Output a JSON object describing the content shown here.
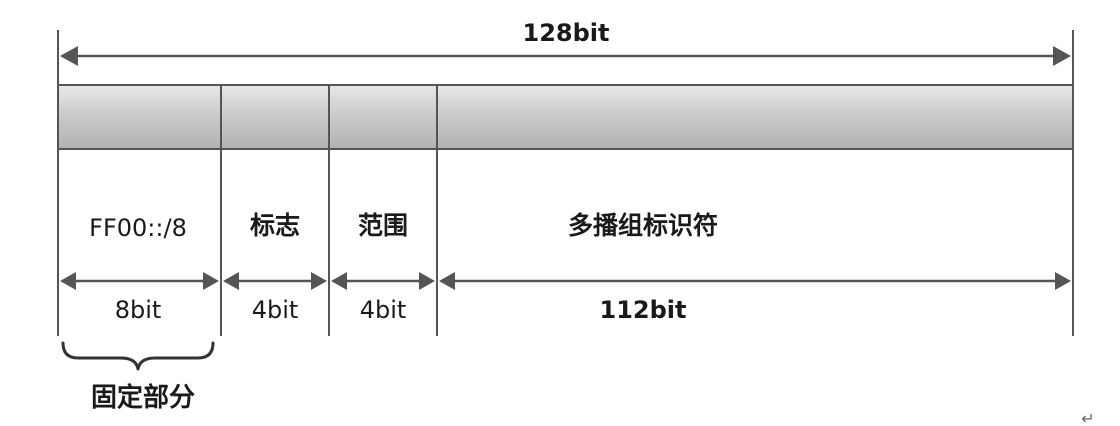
{
  "total_width_label": "128bit",
  "fields": [
    {
      "name": "FF00::/8",
      "width_label": "8bit"
    },
    {
      "name": "标志",
      "width_label": "4bit"
    },
    {
      "name": "范围",
      "width_label": "4bit"
    },
    {
      "name": "多播组标识符",
      "width_label": "112bit"
    }
  ],
  "fixed_part_label": "固定部分",
  "return_mark": "↵",
  "colors": {
    "line": "#555555",
    "bar_top": "#e6e6e6",
    "bar_mid": "#c6c6c6",
    "bar_bottom": "#b0b0b0"
  }
}
